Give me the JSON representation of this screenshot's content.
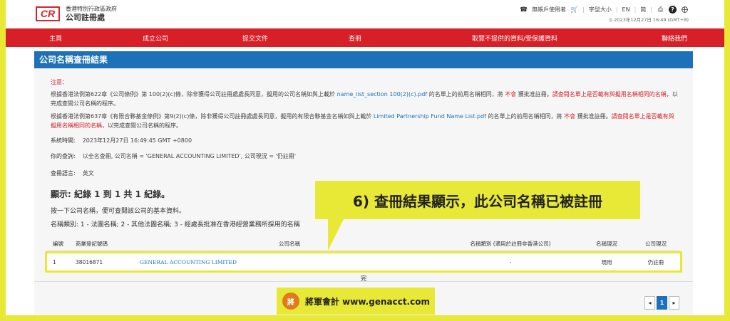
{
  "header": {
    "logo_mark": "CR",
    "logo_line1": "香港特別行政區政府",
    "logo_line2": "公司註冊處",
    "account_label": "無帳戶使用者",
    "font_size_label": "字型大小",
    "lang_en": "EN",
    "lang_zh": "简",
    "datetime": "2023年12月27日 16:49 (GMT+8)"
  },
  "nav": {
    "items": [
      "主頁",
      "成立公司",
      "提交文件",
      "查冊",
      "取覽不提供的資料/受保護資料",
      "聯絡我們"
    ]
  },
  "panel": {
    "title": "公司名稱查冊結果"
  },
  "notes": {
    "label": "注意：",
    "para1_a": "根據香港法例第622章《公司條例》第 100(2)(c)條，除非獲得公司註冊處處長同意，擬用的公司名稱如與上載於 ",
    "para1_link": "name_list_section 100(2)(c).pdf",
    "para1_b": " 的名單上的前用名稱相同，將 ",
    "para1_red1": "不會",
    "para1_c": " 獲批准註冊。",
    "para1_red2": "請查閱名單上是否載有與擬用名稱相同的名稱",
    "para1_d": "，以完成查閱公司名稱的程序。",
    "para2_a": "根據香港法例第637章《有限合夥基金條例》第9(2)(c)條，除非獲得公司註冊處處長同意，擬用的有限合夥基金名稱如與上載於 ",
    "para2_link": "Limited Partnership Fund Name List.pdf",
    "para2_b": " 的名單上的前用名稱相同，將 ",
    "para2_red1": "不會",
    "para2_c": " 獲批准註冊。",
    "para2_red2": "請查閱名單上是否載有與擬用名稱相同的名稱",
    "para2_d": "，以完成查閱公司名稱的程序。"
  },
  "info": {
    "system_time_label": "系統時間:",
    "system_time_value": "2023年12月27日 16:49:45 GMT +0800",
    "query_label": "你的查詢:",
    "query_value": "以全名查冊, 公司名稱 = 'GENERAL ACCOUNTING LIMITED', 公司現況 = '仍註冊'",
    "language_label": "查冊語言:",
    "language_value": "英文"
  },
  "results": {
    "heading": "顯示: 紀錄 1 到 1 共 1 紀錄。",
    "hint": "按一下公司名稱，便可查閱該公司的基本資料。",
    "legend": "名稱類別: 1 - 法團名稱; 2 - 其他法團名稱; 3 - 經處長批准在香港經營業務所採用的名稱",
    "columns": [
      "編號",
      "商業登記號碼",
      "公司名稱",
      "名稱類別 (適用於註冊非香港公司)",
      "名稱現況",
      "公司現況"
    ],
    "rows": [
      {
        "no": "1",
        "br": "38016871",
        "name": "GENERAL ACCOUNTING LIMITED",
        "category": "-",
        "name_status": "現用",
        "company_status": "仍註冊"
      }
    ],
    "end_text": "完"
  },
  "pager": {
    "prev": "◂",
    "current": "1",
    "next": "▸"
  },
  "callout": {
    "text": "6) 查冊結果顯示，此公司名稱已被註冊"
  },
  "brand": {
    "logo_text": "將",
    "text": "將軍會計 www.genacct.com"
  },
  "colors": {
    "accent_yellow": "#e8e836",
    "nav_red": "#d61f26",
    "panel_blue": "#1d71b8"
  }
}
